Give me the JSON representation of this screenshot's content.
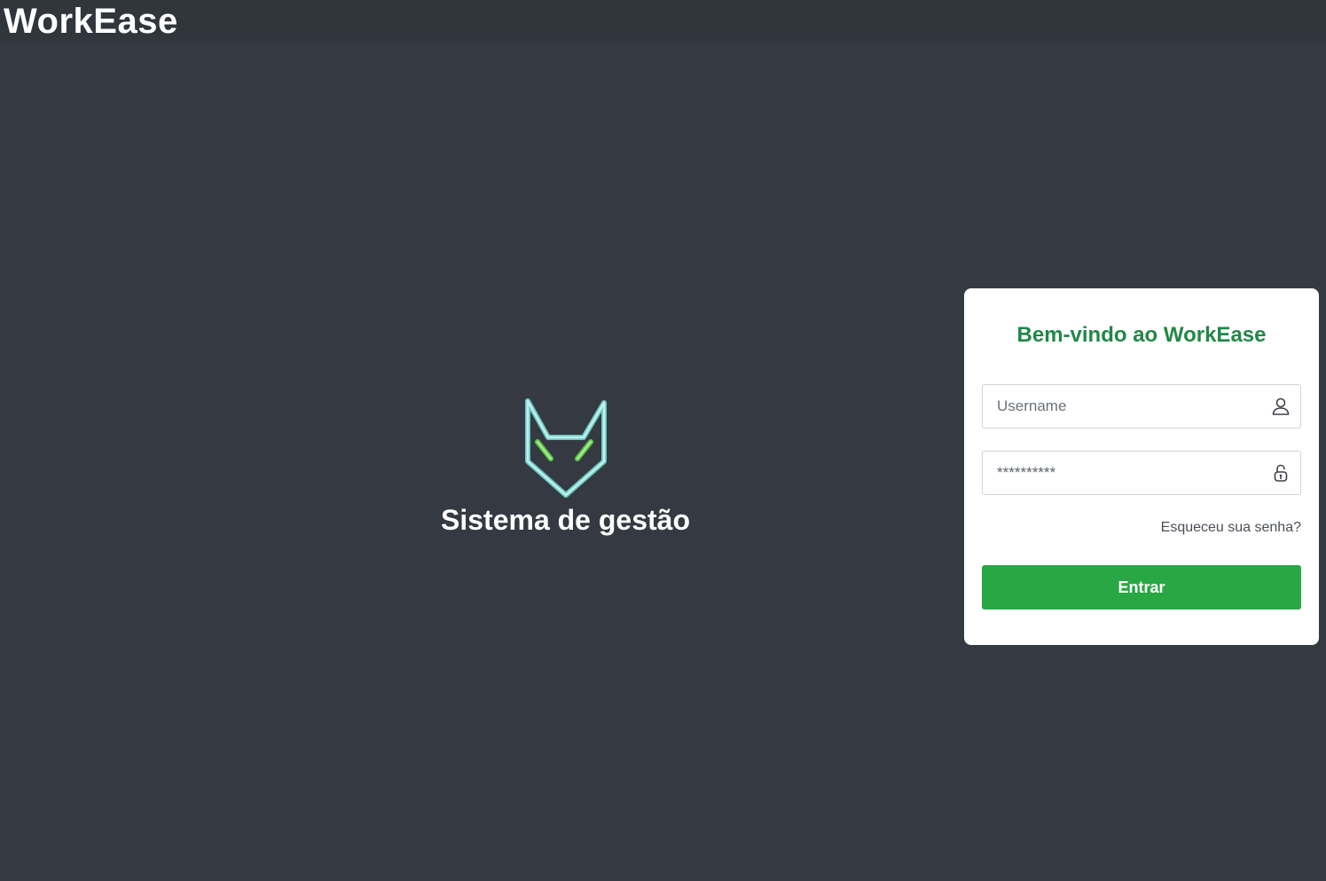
{
  "app": {
    "title": "WorkEase"
  },
  "hero": {
    "title": "Sistema de gestão",
    "logo_icon": "fox-head-logo"
  },
  "login": {
    "title": "Bem-vindo ao WorkEase",
    "username": {
      "placeholder": "Username",
      "value": "",
      "icon": "user-icon"
    },
    "password": {
      "placeholder": "",
      "value": "**********",
      "icon": "lock-icon"
    },
    "forgot_label": "Esqueceu sua senha?",
    "submit_label": "Entrar"
  },
  "colors": {
    "background": "#353a42",
    "accent": "#29a745",
    "title_green": "#228747",
    "logo_outline": "#a8e6e2",
    "logo_eyes": "#7ed957"
  }
}
